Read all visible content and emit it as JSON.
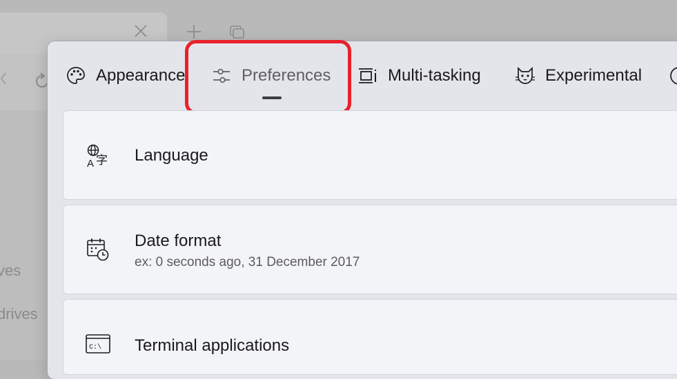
{
  "background": {
    "sidebar_fragments": [
      "ves",
      "drives"
    ]
  },
  "settings": {
    "tabs": [
      {
        "label": "Appearance",
        "icon": "palette-icon"
      },
      {
        "label": "Preferences",
        "icon": "sliders-icon",
        "selected": true
      },
      {
        "label": "Multi-tasking",
        "icon": "multitasking-icon"
      },
      {
        "label": "Experimental",
        "icon": "cat-icon"
      },
      {
        "label": "",
        "icon": "info-icon"
      }
    ],
    "cards": [
      {
        "title": "Language",
        "icon": "language-icon"
      },
      {
        "title": "Date format",
        "subtitle": "ex: 0 seconds ago, 31 December 2017",
        "icon": "calendar-clock-icon"
      },
      {
        "title": "Terminal applications",
        "icon": "terminal-icon"
      }
    ]
  },
  "colors": {
    "highlight_border": "#e8212b",
    "dialog_background": "#e4e5ea",
    "card_background": "#f3f4f8"
  }
}
